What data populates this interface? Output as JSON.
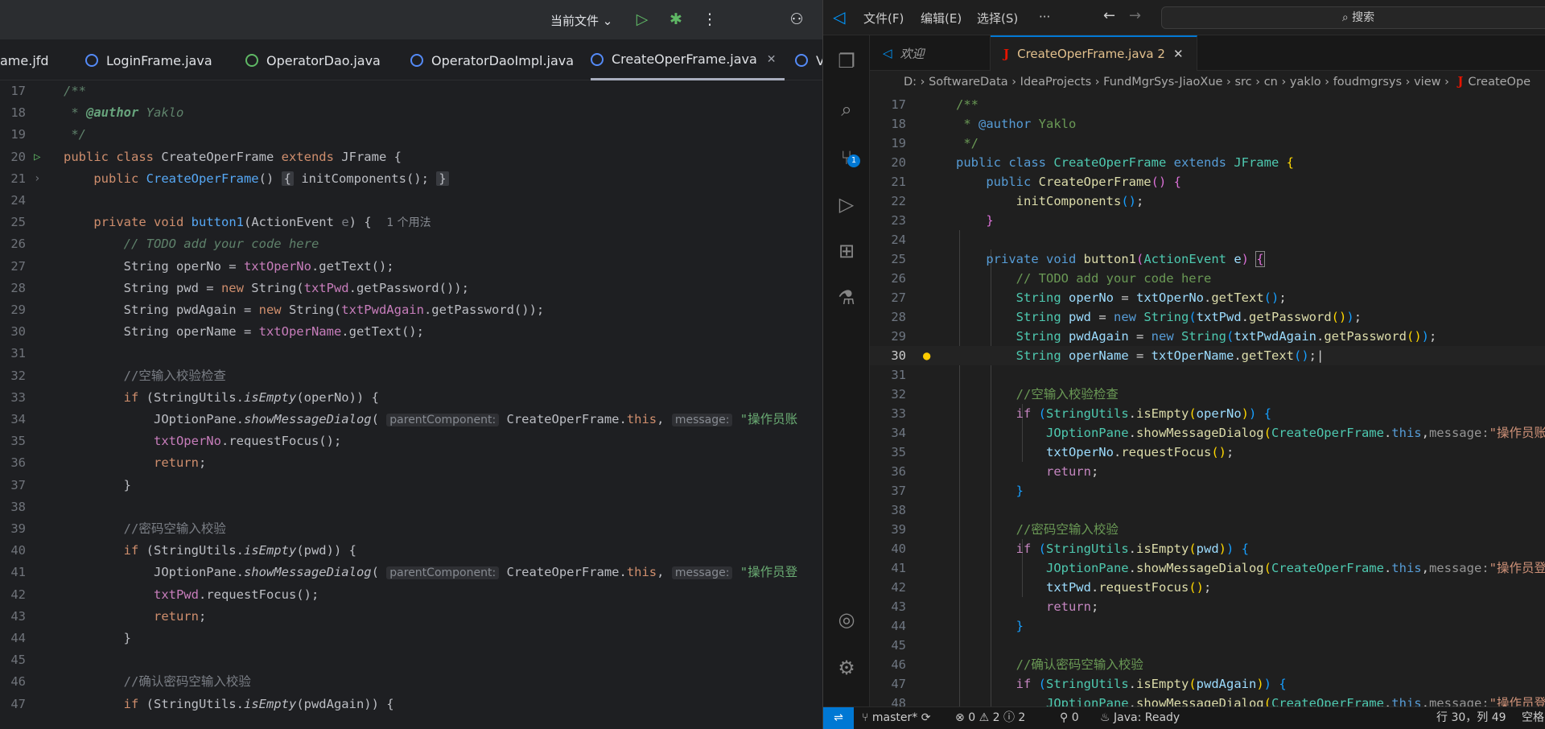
{
  "idea": {
    "topbar": {
      "current_file": "当前文件"
    },
    "tabs": [
      {
        "label": "ame.jfd"
      },
      {
        "label": "LoginFrame.java"
      },
      {
        "label": "OperatorDao.java"
      },
      {
        "label": "OperatorDaoImpl.java"
      },
      {
        "label": "CreateOperFrame.java"
      },
      {
        "label": "V"
      }
    ],
    "usage_hint": "1 个用法",
    "hint_parent": "parentComponent:",
    "hint_message": "message:",
    "lines": {
      "l17": "17",
      "l18": "18",
      "l19": "19",
      "l20": "20",
      "l21": "21",
      "l24": "24",
      "l25": "25",
      "l26": "26",
      "l27": "27",
      "l28": "28",
      "l29": "29",
      "l30": "30",
      "l31": "31",
      "l32": "32",
      "l33": "33",
      "l34": "34",
      "l35": "35",
      "l36": "36",
      "l37": "37",
      "l38": "38",
      "l39": "39",
      "l40": "40",
      "l41": "41",
      "l42": "42",
      "l43": "43",
      "l44": "44",
      "l45": "45",
      "l46": "46",
      "l47": "47"
    },
    "text": {
      "doc_open": "/**",
      "author_tag": "@author",
      "author": "Yaklo",
      "doc_close": "*/",
      "todo": "// TODO add your code here",
      "c_empty": "//空输入校验检查",
      "c_pwd": "//密码空输入校验",
      "c_again": "//确认密码空输入校验",
      "msg1": "\"操作员账",
      "msg2": "\"操作员登"
    }
  },
  "vscode": {
    "menu": [
      "文件(F)",
      "编辑(E)",
      "选择(S)",
      "···"
    ],
    "search": "搜索",
    "tabs": [
      {
        "label": "欢迎"
      },
      {
        "label": "CreateOperFrame.java",
        "problems": "2"
      }
    ],
    "breadcrumb": [
      "D:",
      "SoftwareData",
      "IdeaProjects",
      "FundMgrSys-JiaoXue",
      "src",
      "cn",
      "yaklo",
      "foudmgrsys",
      "view",
      "CreateOpe"
    ],
    "scm_badge": "1",
    "text": {
      "todo": "// TODO add your code here",
      "c_empty": "//空输入校验检查",
      "c_pwd": "//密码空输入校验",
      "c_again": "//确认密码空输入校验",
      "msg1": "\"操作员账",
      "msg2": "\"操作员登",
      "hint_message": "message:"
    },
    "status": {
      "branch": "master*",
      "errors": "0",
      "warnings": "2",
      "info": "2",
      "ports": "0",
      "java": "Java: Ready",
      "position": "行 30，列 49",
      "spaces": "空格"
    }
  },
  "colors": {
    "idea_bg": "#1e1f22",
    "vscode_bg": "#1f1f1f",
    "accent": "#0078d4"
  }
}
